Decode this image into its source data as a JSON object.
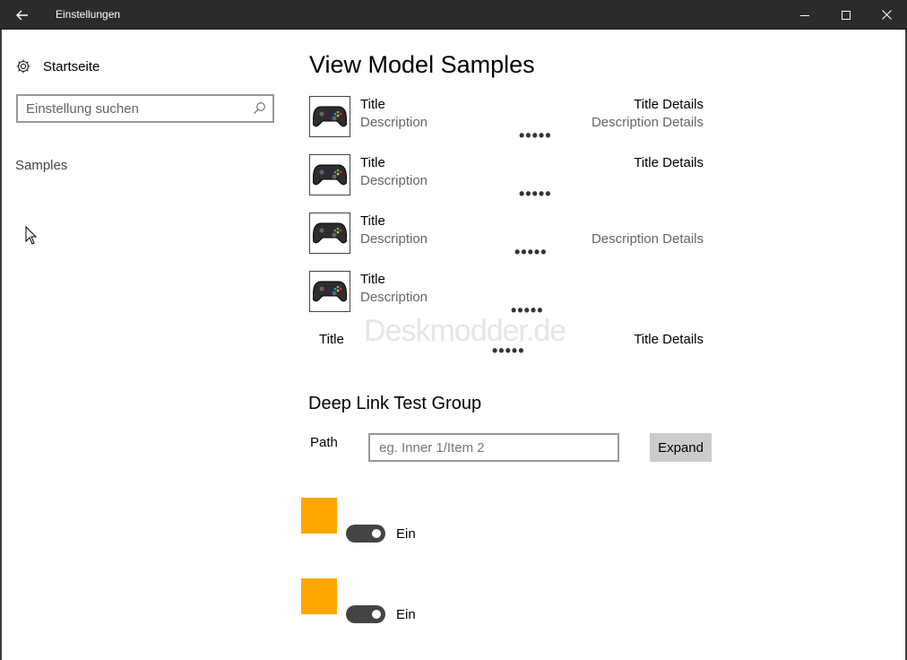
{
  "window": {
    "title": "Einstellungen",
    "back_icon": "arrow-left-icon",
    "minimize_icon": "minimize-icon",
    "maximize_icon": "maximize-icon",
    "close_icon": "close-icon"
  },
  "sidebar": {
    "home_label": "Startseite",
    "home_icon": "gear-icon",
    "search_placeholder": "Einstellung suchen",
    "search_icon": "search-icon",
    "nav_items": [
      {
        "label": "Samples"
      }
    ]
  },
  "main": {
    "page_title": "View Model Samples",
    "items": [
      {
        "title": "Title",
        "description": "Description",
        "title_details": "Title Details",
        "description_details": "Description Details",
        "dots": "•••••",
        "thumb_icon": "gamepad-icon"
      },
      {
        "title": "Title",
        "description": "Description",
        "title_details": "Title Details",
        "description_details": "",
        "dots": "•••••",
        "thumb_icon": "gamepad-icon"
      },
      {
        "title": "Title",
        "description": "Description",
        "title_details": "",
        "description_details": "Description Details",
        "dots": "•••••",
        "thumb_icon": "gamepad-icon"
      },
      {
        "title": "Title",
        "description": "Description",
        "title_details": "",
        "description_details": "",
        "dots": "•••••",
        "thumb_icon": "gamepad-icon"
      }
    ],
    "last_item": {
      "title": "Title",
      "title_details": "Title Details",
      "dots": "•••••"
    },
    "watermark": "Deskmodder.de",
    "deep_link": {
      "section_title": "Deep Link Test Group",
      "path_label": "Path",
      "path_placeholder": "eg. Inner 1/Item 2",
      "expand_label": "Expand"
    },
    "toggles": [
      {
        "label": "Ein",
        "state": "on",
        "swatch_color": "#FFA500"
      },
      {
        "label": "Ein",
        "state": "on",
        "swatch_color": "#FFA500"
      }
    ]
  },
  "colors": {
    "titlebar": "#2b2b2b",
    "accent_swatch": "#FFA500",
    "toggle_track": "#444444",
    "button_bg": "#cccccc"
  }
}
